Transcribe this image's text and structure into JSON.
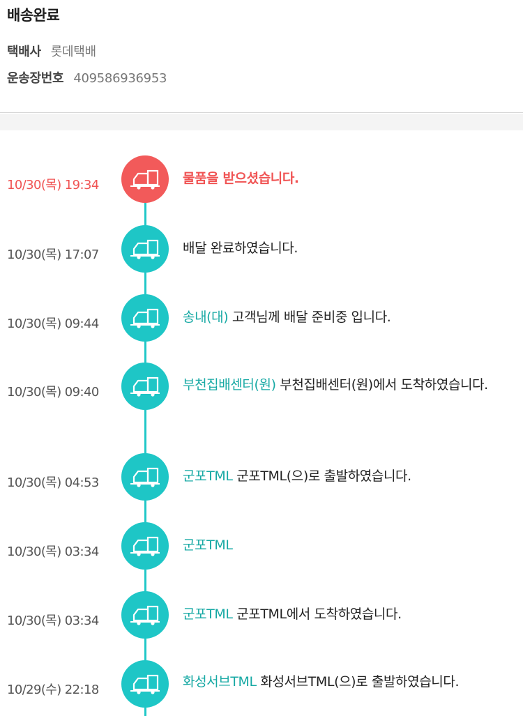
{
  "header": {
    "status": "배송완료",
    "carrier_label": "택배사",
    "carrier_value": "롯데택배",
    "tracking_label": "운송장번호",
    "tracking_value": "409586936953"
  },
  "colors": {
    "accent_teal": "#1ec6c6",
    "location_teal": "#17a9a4",
    "highlight_red": "#f25a5a"
  },
  "icon": "delivery-truck-icon",
  "events": [
    {
      "time": "10/30(목) 19:34",
      "location": "",
      "message": "물품을 받으셨습니다."
    },
    {
      "time": "10/30(목) 17:07",
      "location": "",
      "message": "배달 완료하였습니다."
    },
    {
      "time": "10/30(목) 09:44",
      "location": "송내(대)",
      "message": "고객님께 배달 준비중 입니다."
    },
    {
      "time": "10/30(목) 09:40",
      "location": "부천집배센터(원)",
      "message": "부천집배센터(원)에서 도착하였습니다."
    },
    {
      "time": "10/30(목) 04:53",
      "location": "군포TML",
      "message": "군포TML(으)로 출발하였습니다."
    },
    {
      "time": "10/30(목) 03:34",
      "location": "군포TML",
      "message": ""
    },
    {
      "time": "10/30(목) 03:34",
      "location": "군포TML",
      "message": "군포TML에서 도착하였습니다."
    },
    {
      "time": "10/29(수) 22:18",
      "location": "화성서브TML",
      "message": "화성서브TML(으)로 출발하였습니다."
    }
  ]
}
